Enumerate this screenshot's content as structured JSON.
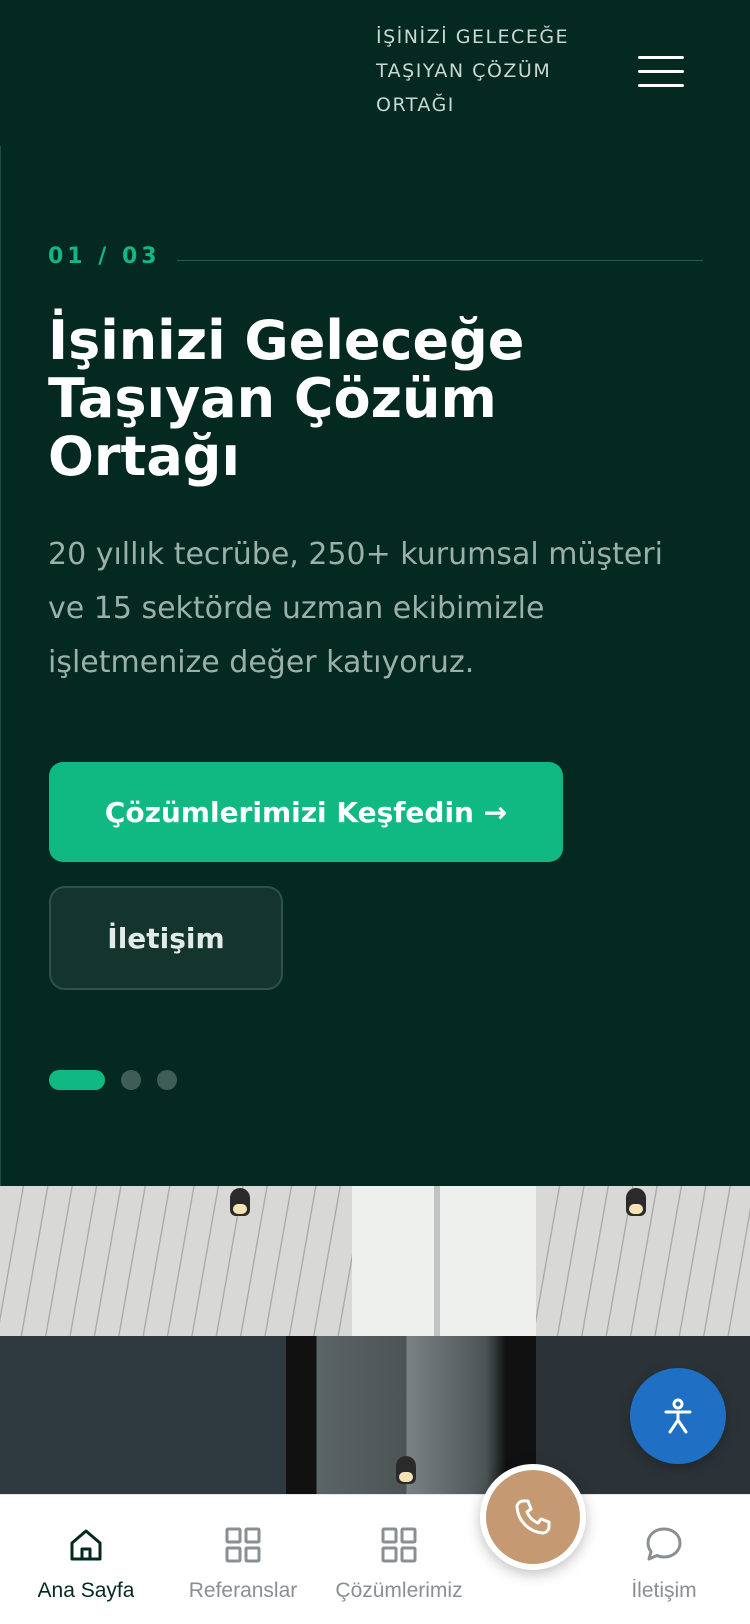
{
  "header": {
    "tagline": "İŞİNİZİ GELECEĞE TAŞIYAN ÇÖZÜM ORTAĞI",
    "menu_icon": "hamburger-menu-icon"
  },
  "hero": {
    "slide_counter": "01 / 03",
    "current_slide": 1,
    "total_slides": 3,
    "title": "İşinizi Geleceğe Taşıyan Çözüm Ortağı",
    "description": "20 yıllık tecrübe, 250+ kurumsal müşteri ve 15 sektörde uzman ekibimizle işletmenize değer katıyoruz.",
    "primary_button": "Çözümlerimizi Keşfedin →",
    "secondary_button": "İletişim"
  },
  "colors": {
    "background": "#032920",
    "accent": "#10b981",
    "call_button": "#c59a72",
    "accessibility_button": "#1f6fc5"
  },
  "accessibility_button": {
    "icon": "accessibility-icon"
  },
  "bottom_nav": {
    "items": [
      {
        "label": "Ana Sayfa",
        "icon": "home-icon",
        "active": true
      },
      {
        "label": "Referanslar",
        "icon": "grid-icon",
        "active": false
      },
      {
        "label": "Çözümlerimiz",
        "icon": "grid-icon",
        "active": false
      },
      {
        "label": "İletişim",
        "icon": "chat-bubble-icon",
        "active": false
      }
    ],
    "call_icon": "phone-icon"
  }
}
